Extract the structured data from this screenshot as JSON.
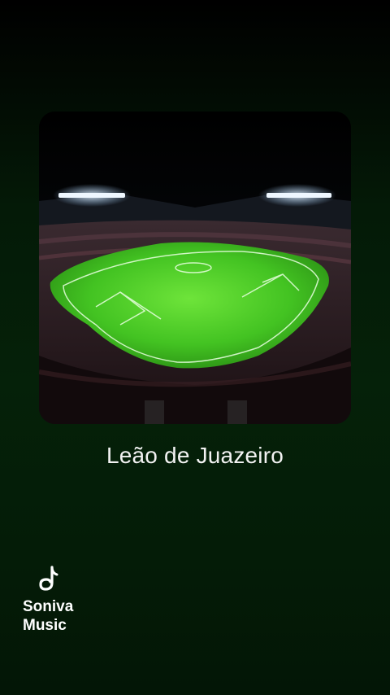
{
  "track": {
    "title": "Leão de Juazeiro",
    "artwork_icon": "stadium-artwork"
  },
  "brand": {
    "name": "Soniva\nMusic",
    "icon": "music-note-logo-icon"
  },
  "colors": {
    "background_top": "#000000",
    "background_bottom": "#052109",
    "pitch": "#4ccf2c",
    "title_text": "#f2f2f2"
  }
}
